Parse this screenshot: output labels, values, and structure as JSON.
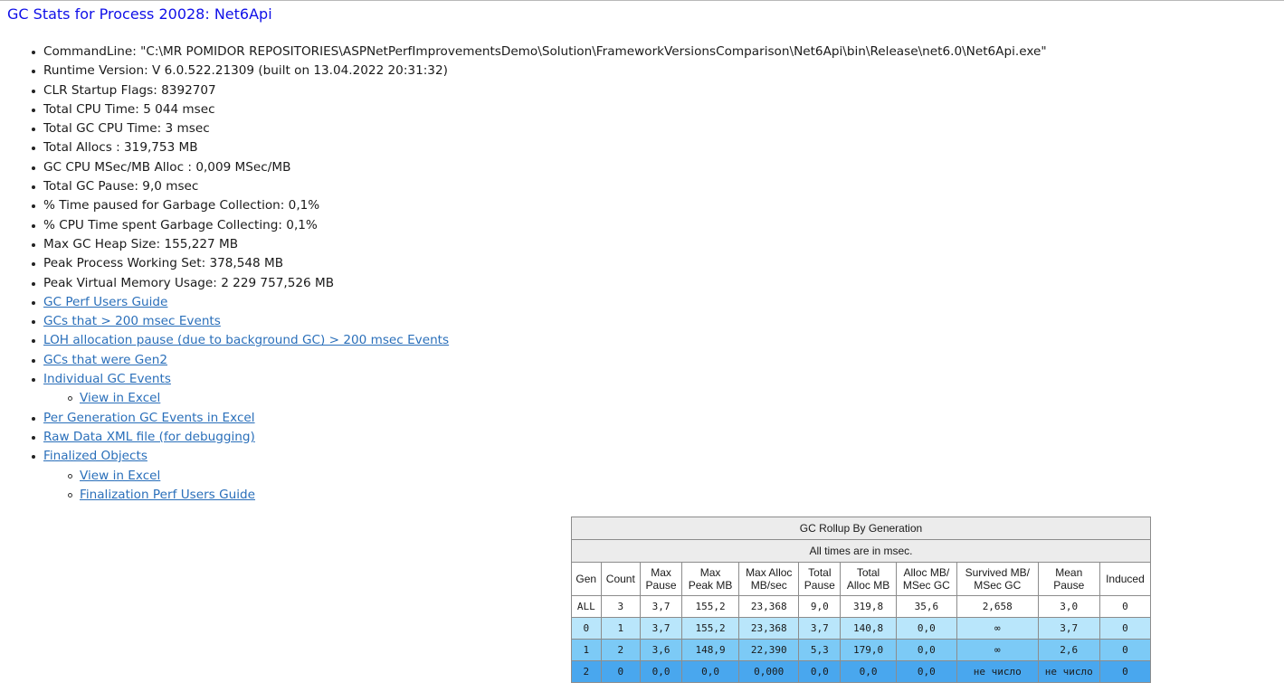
{
  "title": "GC Stats for Process 20028: Net6Api",
  "info_items": [
    {
      "text": "CommandLine: \"C:\\MR POMIDOR REPOSITORIES\\ASPNetPerfImprovementsDemo\\Solution\\FrameworkVersionsComparison\\Net6Api\\bin\\Release\\net6.0\\Net6Api.exe\""
    },
    {
      "text": "Runtime Version: V 6.0.522.21309 (built on 13.04.2022 20:31:32)"
    },
    {
      "text": "CLR Startup Flags: 8392707"
    },
    {
      "text": "Total CPU Time: 5 044 msec"
    },
    {
      "text": "Total GC CPU Time: 3 msec"
    },
    {
      "text": "Total Allocs : 319,753 MB"
    },
    {
      "text": "GC CPU MSec/MB Alloc : 0,009 MSec/MB"
    },
    {
      "text": "Total GC Pause: 9,0 msec"
    },
    {
      "text": "% Time paused for Garbage Collection: 0,1%"
    },
    {
      "text": "% CPU Time spent Garbage Collecting: 0,1%"
    },
    {
      "text": "Max GC Heap Size: 155,227 MB"
    },
    {
      "text": "Peak Process Working Set: 378,548 MB"
    },
    {
      "text": "Peak Virtual Memory Usage: 2 229 757,526 MB"
    }
  ],
  "links": {
    "gc_perf_users_guide": "GC Perf Users Guide",
    "gcs_over_200": "GCs that > 200 msec Events",
    "loh_pause": "LOH allocation pause (due to background GC) > 200 msec Events",
    "gcs_gen2": "GCs that were Gen2",
    "individual_gc_events": "Individual GC Events",
    "individual_view_excel": "View in Excel",
    "per_generation_excel": "Per Generation GC Events in Excel",
    "raw_xml": "Raw Data XML file (for debugging)",
    "finalized_objects": "Finalized Objects",
    "finalized_view_excel": "View in Excel",
    "finalization_guide": "Finalization Perf Users Guide"
  },
  "rollup": {
    "caption": "GC Rollup By Generation",
    "subcaption": "All times are in msec.",
    "headers": [
      [
        "Gen"
      ],
      [
        "Count"
      ],
      [
        "Max",
        "Pause"
      ],
      [
        "Max",
        "Peak MB"
      ],
      [
        "Max Alloc",
        "MB/sec"
      ],
      [
        "Total",
        "Pause"
      ],
      [
        "Total",
        "Alloc MB"
      ],
      [
        "Alloc MB/",
        "MSec GC"
      ],
      [
        "Survived MB/",
        "MSec GC"
      ],
      [
        "Mean",
        "Pause"
      ],
      [
        "Induced"
      ]
    ],
    "rows": [
      {
        "cells": [
          "ALL",
          "3",
          "3,7",
          "155,2",
          "23,368",
          "9,0",
          "319,8",
          "35,6",
          "2,658",
          "3,0",
          "0"
        ]
      },
      {
        "cells": [
          "0",
          "1",
          "3,7",
          "155,2",
          "23,368",
          "3,7",
          "140,8",
          "0,0",
          "∞",
          "3,7",
          "0"
        ]
      },
      {
        "cells": [
          "1",
          "2",
          "3,6",
          "148,9",
          "22,390",
          "5,3",
          "179,0",
          "0,0",
          "∞",
          "2,6",
          "0"
        ]
      },
      {
        "cells": [
          "2",
          "0",
          "0,0",
          "0,0",
          "0,000",
          "0,0",
          "0,0",
          "0,0",
          "не число",
          "не число",
          "0"
        ]
      }
    ],
    "row_colors": [
      "#ffffff",
      "#b9e6fb",
      "#7ccaf6",
      "#49a7ee"
    ]
  }
}
